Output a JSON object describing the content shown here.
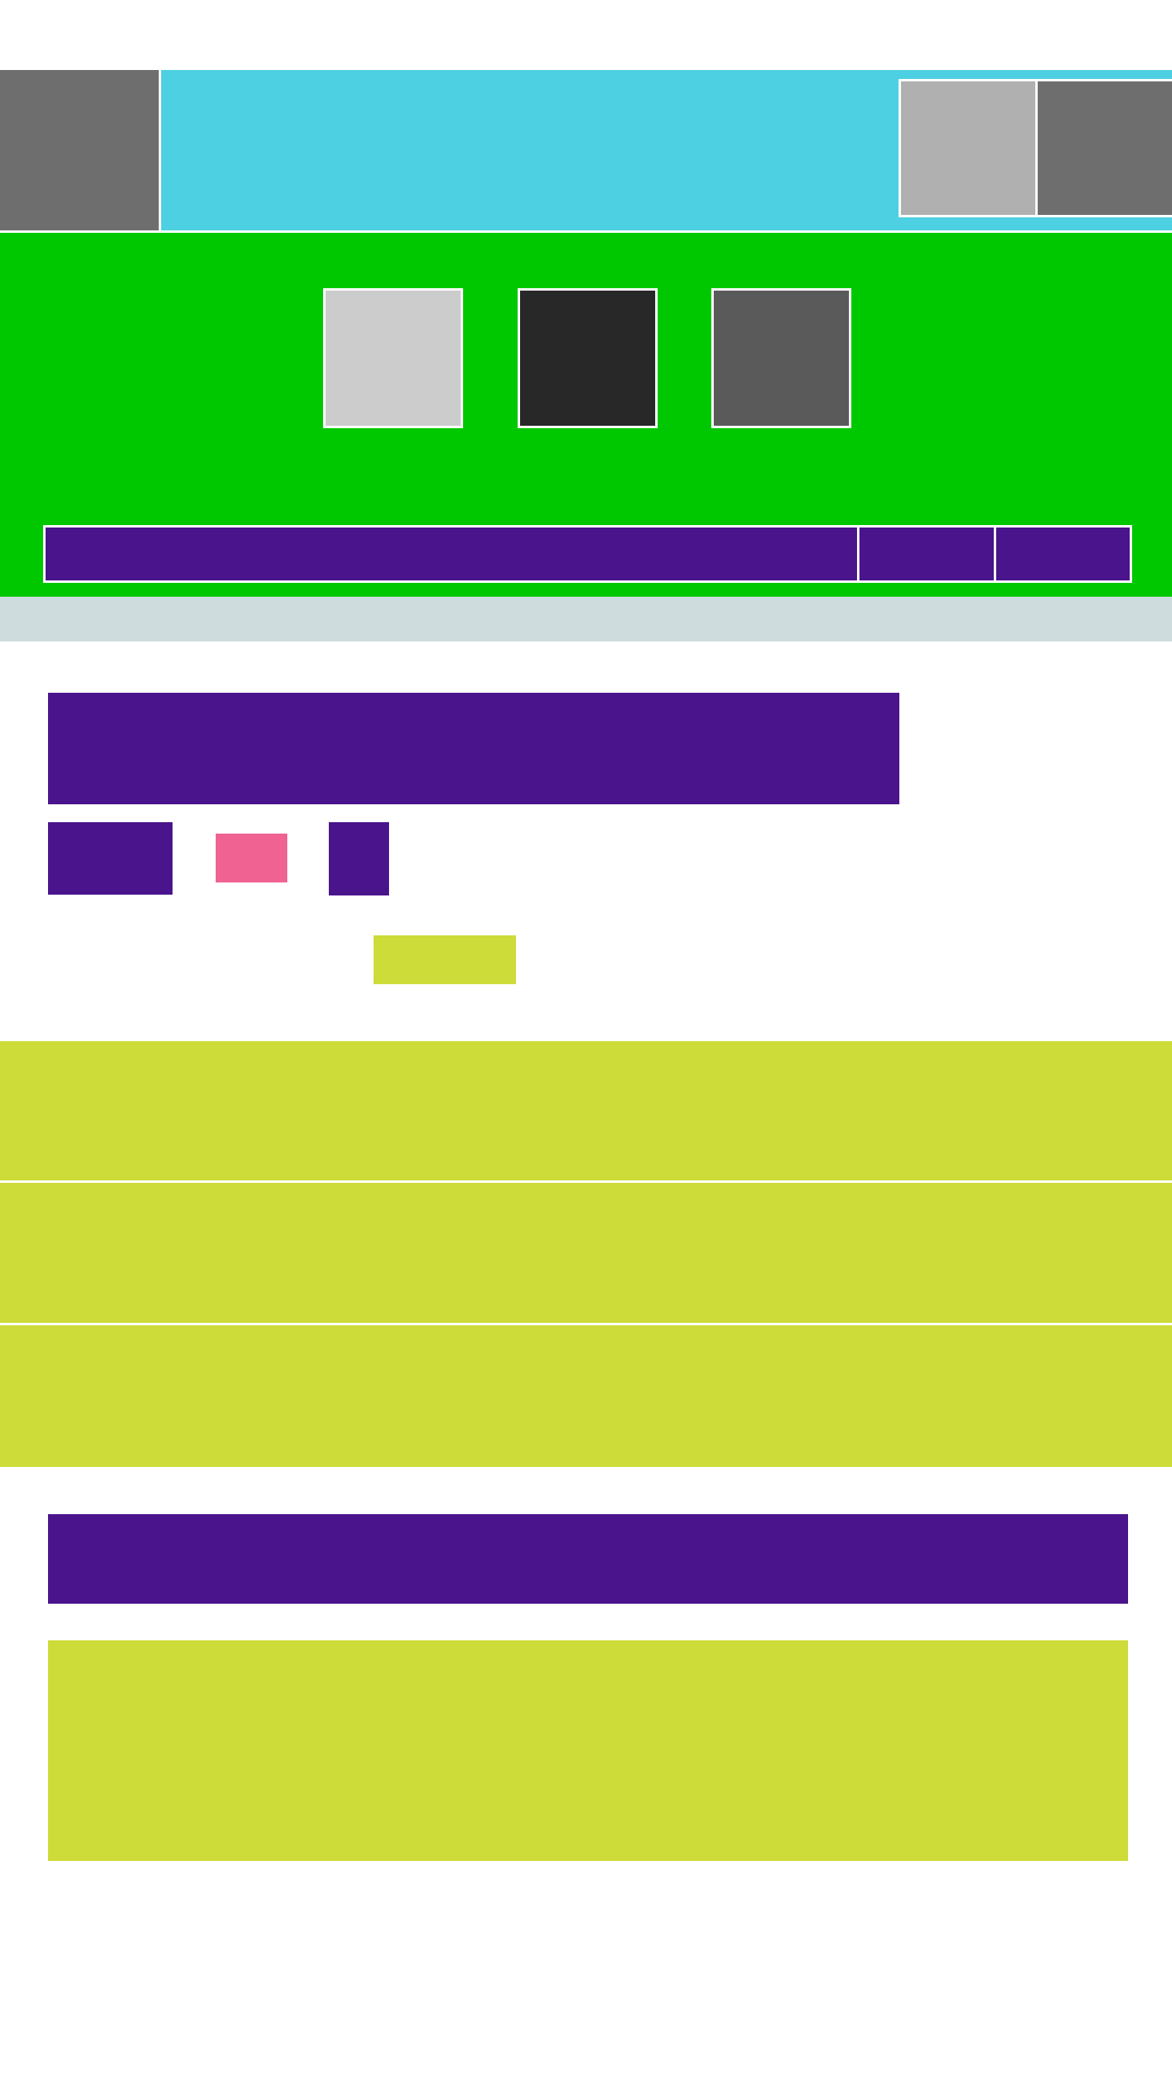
{
  "colors": {
    "page_bg": "#ffffff",
    "header_bg": "#4dd0e1",
    "hero_bg": "#00c800",
    "subbar_bg": "#cfdcdd",
    "primary_purple": "#4a148c",
    "accent_pink": "#f06292",
    "lime": "#cddc39",
    "tile_gray_mid": "#6e6e6e",
    "tile_gray_light": "#b0b0b0",
    "tile_gray_lighter": "#cccccc",
    "tile_gray_dark": "#282828",
    "tile_gray_darker": "#5a5a5a",
    "divider": "#ffffff"
  },
  "header": {
    "logo_icon": "image-placeholder-icon",
    "right_icons": [
      "image-placeholder-icon",
      "image-placeholder-icon"
    ]
  },
  "hero": {
    "tiles": [
      "image-placeholder-icon",
      "image-placeholder-icon",
      "image-placeholder-icon"
    ]
  }
}
